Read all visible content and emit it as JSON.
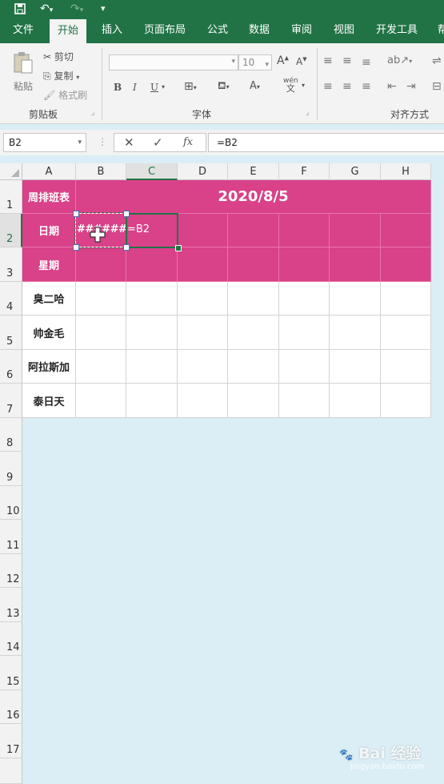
{
  "ribbon_tabs": [
    {
      "label": "文件",
      "active": false
    },
    {
      "label": "开始",
      "active": true
    },
    {
      "label": "插入",
      "active": false
    },
    {
      "label": "页面布局",
      "active": false
    },
    {
      "label": "公式",
      "active": false
    },
    {
      "label": "数据",
      "active": false
    },
    {
      "label": "审阅",
      "active": false
    },
    {
      "label": "视图",
      "active": false
    },
    {
      "label": "开发工具",
      "active": false
    },
    {
      "label": "帮",
      "active": false
    }
  ],
  "clipboard": {
    "paste": "粘贴",
    "cut": "剪切",
    "copy": "复制",
    "format_painter": "格式刷",
    "group": "剪贴板"
  },
  "font": {
    "size": "10",
    "bold": "B",
    "italic": "I",
    "underline": "U",
    "grow": "A",
    "shrink": "A",
    "color_a": "A",
    "wen": "wén",
    "wen_char": "文",
    "group": "字体"
  },
  "align": {
    "group": "对齐方式"
  },
  "formula_bar": {
    "name_box": "B2",
    "cancel": "✕",
    "enter": "✓",
    "fx": "fx",
    "content": "=B2"
  },
  "columns": [
    "A",
    "B",
    "C",
    "D",
    "E",
    "F",
    "G",
    "H"
  ],
  "rows": [
    "1",
    "2",
    "3",
    "4",
    "5",
    "6",
    "7",
    "8",
    "9",
    "10",
    "11",
    "12",
    "13",
    "14",
    "15",
    "16",
    "17"
  ],
  "sheet": {
    "a1": "周排班表",
    "title": "2020/8/5",
    "a2": "日期",
    "b2": "#######",
    "c2": "=B2",
    "a3": "星期",
    "names": [
      "臭二哈",
      "帅金毛",
      "阿拉斯加",
      "泰日天"
    ]
  },
  "watermark": {
    "text": "Bai  经验",
    "sub": "jingyan.baidu.com"
  },
  "colors": {
    "excel_green": "#217346",
    "header_pink": "#d94188",
    "background": "#dbeef5"
  }
}
